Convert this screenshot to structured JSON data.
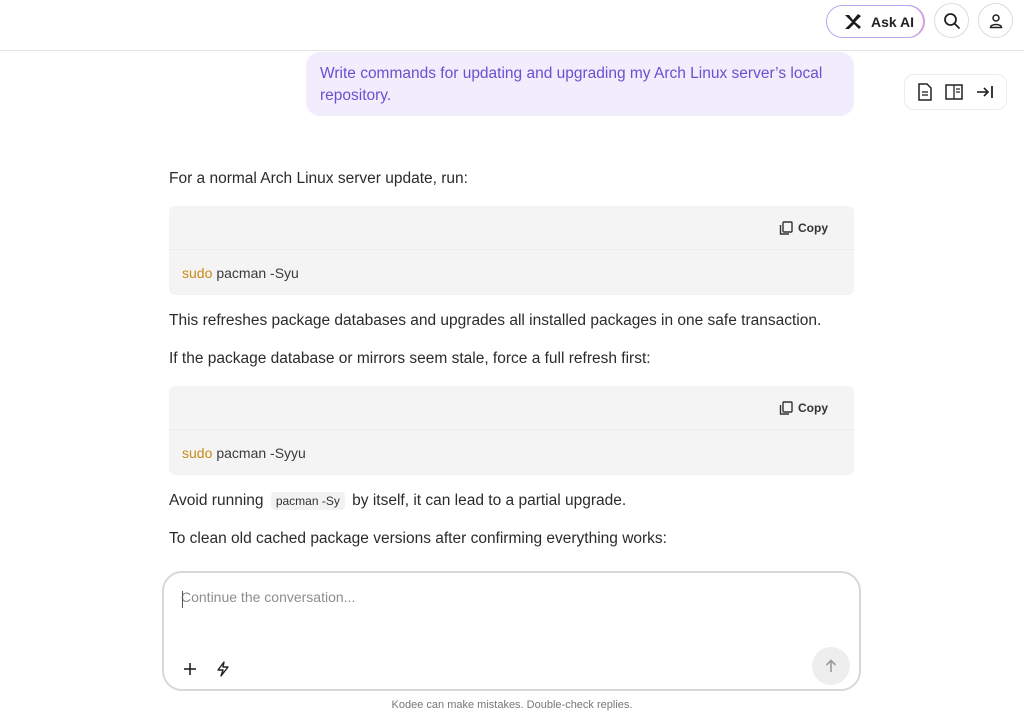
{
  "header": {
    "ask_ai_label": "Ask AI"
  },
  "conversation": {
    "user_message": "Write commands for updating and upgrading my Arch Linux server’s local repository.",
    "intro": "For a normal Arch Linux server update, run:",
    "copy_label": "Copy",
    "code_blocks": [
      {
        "keyword": "sudo",
        "command": "pacman -Syu"
      },
      {
        "keyword": "sudo",
        "command": "pacman -Syyu"
      }
    ],
    "explanation": "This refreshes package databases and upgrades all installed packages in one safe transaction.",
    "stale_note": "If the package database or mirrors seem stale, force a full refresh first:",
    "avoid_prefix": "Avoid running",
    "avoid_code": "pacman -Sy",
    "avoid_suffix": "by itself, it can lead to a partial upgrade.",
    "clean_note": "To clean old cached package versions after confirming everything works:"
  },
  "composer": {
    "placeholder": "Continue the conversation...",
    "value": ""
  },
  "footer": {
    "disclaimer": "Kodee can make mistakes. Double-check replies."
  },
  "icons": {
    "ask_ai": "sparkle-icon",
    "search": "search-icon",
    "user": "user-icon",
    "document": "document-icon",
    "book": "book-icon",
    "collapse": "collapse-right-icon",
    "copy": "copy-icon",
    "add": "plus-icon",
    "tools": "lightning-icon",
    "send": "arrow-up-icon"
  },
  "colors": {
    "user_text": "#6a4fd0",
    "user_bubble": "#f1edfd",
    "keyword": "#c98a17"
  }
}
